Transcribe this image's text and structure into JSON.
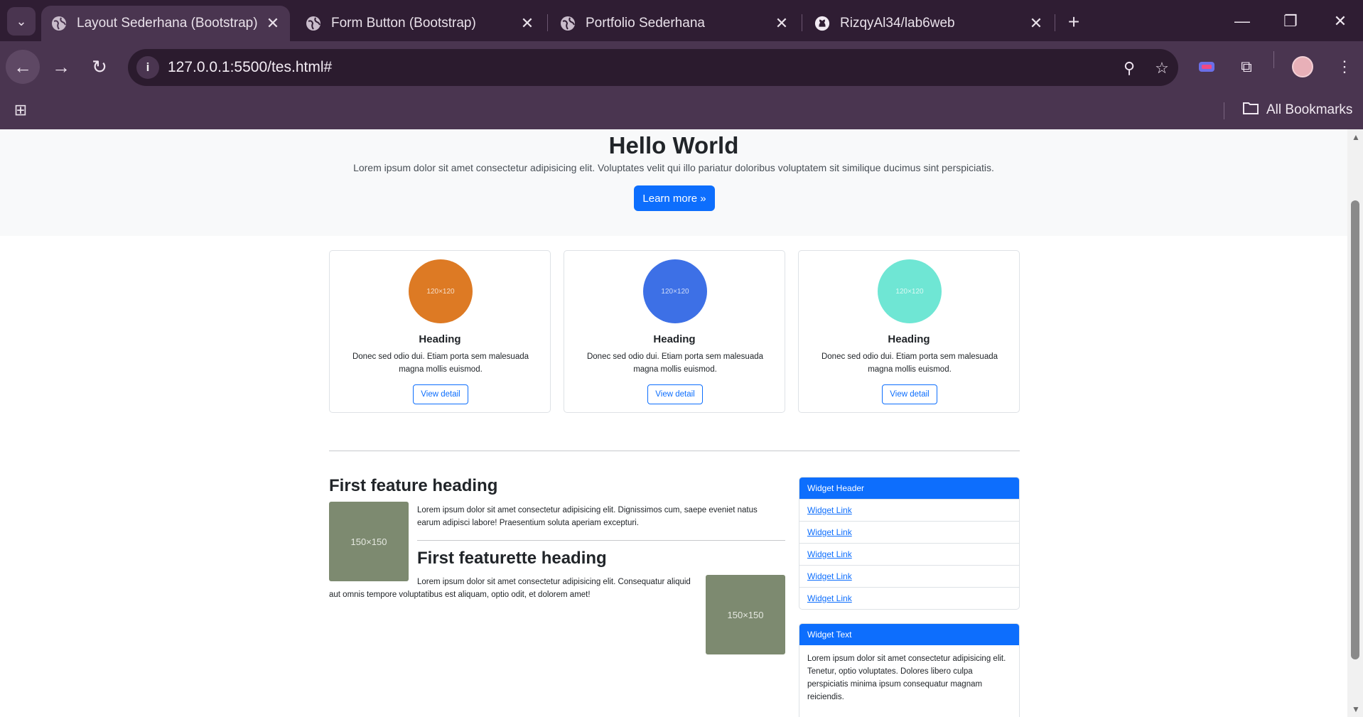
{
  "browser": {
    "tabs": [
      {
        "title": "Layout Sederhana (Bootstrap)",
        "active": true,
        "favicon": "globe-icon"
      },
      {
        "title": "Form Button (Bootstrap)",
        "active": false,
        "favicon": "globe-icon"
      },
      {
        "title": "Portfolio Sederhana",
        "active": false,
        "favicon": "globe-icon"
      },
      {
        "title": "RizqyAl34/lab6web",
        "active": false,
        "favicon": "github-icon"
      }
    ],
    "url": "127.0.0.1:5500/tes.html#",
    "bookmarks_label": "All Bookmarks"
  },
  "hero": {
    "title": "Hello World",
    "text": "Lorem ipsum dolor sit amet consectetur adipisicing elit. Voluptates velit qui illo pariatur doloribus voluptatem sit similique ducimus sint perspiciatis.",
    "button": "Learn more »"
  },
  "cards": [
    {
      "placeholder": "120×120",
      "color": "#dd7a24",
      "heading": "Heading",
      "text": "Donec sed odio dui. Etiam porta sem malesuada magna mollis euismod.",
      "button": "View detail"
    },
    {
      "placeholder": "120×120",
      "color": "#3d70e6",
      "heading": "Heading",
      "text": "Donec sed odio dui. Etiam porta sem malesuada magna mollis euismod.",
      "button": "View detail"
    },
    {
      "placeholder": "120×120",
      "color": "#6fe6d4",
      "heading": "Heading",
      "text": "Donec sed odio dui. Etiam porta sem malesuada magna mollis euismod.",
      "button": "View detail"
    }
  ],
  "features": [
    {
      "heading": "First feature heading",
      "image": "150×150",
      "text": "Lorem ipsum dolor sit amet consectetur adipisicing elit. Dignissimos cum, saepe eveniet natus earum adipisci labore! Praesentium soluta aperiam excepturi."
    },
    {
      "heading": "First featurette heading",
      "image": "150×150",
      "text": "Lorem ipsum dolor sit amet consectetur adipisicing elit. Consequatur aliquid aut omnis tempore voluptatibus est aliquam, optio odit, et dolorem amet!"
    }
  ],
  "widgets": {
    "links_header": "Widget Header",
    "links": [
      "Widget Link",
      "Widget Link",
      "Widget Link",
      "Widget Link",
      "Widget Link"
    ],
    "text_header": "Widget Text",
    "text": "Lorem ipsum dolor sit amet consectetur adipisicing elit. Tenetur, optio voluptates. Dolores libero culpa perspiciatis minima ipsum consequatur magnam reiciendis."
  },
  "colors": {
    "primary": "#0d6efd",
    "placeholder_gray": "#7d8a70",
    "chrome": "#4a3550"
  }
}
